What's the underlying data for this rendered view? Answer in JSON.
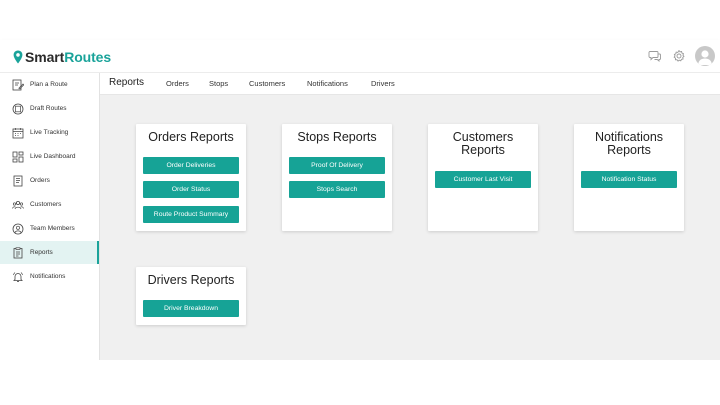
{
  "brand": {
    "name_part1": "Smart",
    "name_part2": "Routes",
    "accent": "#1aa39a"
  },
  "header": {
    "icons": [
      "chat-icon",
      "gear-icon",
      "user-avatar-icon"
    ]
  },
  "sidebar": {
    "items": [
      {
        "label": "Plan a Route",
        "icon": "edit-route-icon"
      },
      {
        "label": "Draft Routes",
        "icon": "draft-icon"
      },
      {
        "label": "Live Tracking",
        "icon": "calendar-icon"
      },
      {
        "label": "Live Dashboard",
        "icon": "dashboard-icon"
      },
      {
        "label": "Orders",
        "icon": "orders-icon"
      },
      {
        "label": "Customers",
        "icon": "customers-icon"
      },
      {
        "label": "Team Members",
        "icon": "team-members-icon"
      },
      {
        "label": "Reports",
        "icon": "reports-icon",
        "active": true
      },
      {
        "label": "Notifications",
        "icon": "bell-icon"
      }
    ]
  },
  "tabs": [
    "Reports",
    "Orders",
    "Stops",
    "Customers",
    "Notifications",
    "Drivers"
  ],
  "cards": {
    "orders": {
      "title": "Orders Reports",
      "buttons": [
        "Order Deliveries",
        "Order Status",
        "Route Product Summary"
      ]
    },
    "stops": {
      "title": "Stops Reports",
      "buttons": [
        "Proof Of Delivery",
        "Stops Search"
      ]
    },
    "customers": {
      "title_line1": "Customers",
      "title_line2": "Reports",
      "buttons": [
        "Customer Last Visit"
      ]
    },
    "notifications": {
      "title_line1": "Notifications",
      "title_line2": "Reports",
      "buttons": [
        "Notification Status"
      ]
    },
    "drivers": {
      "title": "Drivers Reports",
      "buttons": [
        "Driver Breakdown"
      ]
    }
  }
}
